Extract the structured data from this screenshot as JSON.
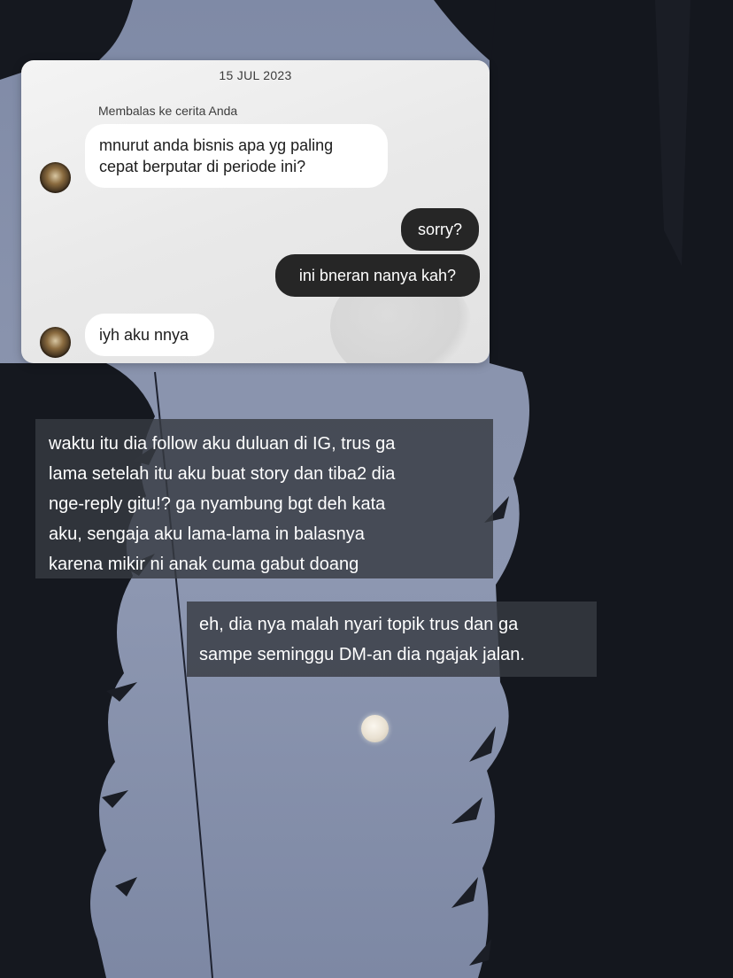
{
  "chat": {
    "date": "15 JUL 2023",
    "reply_note": "Membalas ke cerita Anda",
    "messages": [
      {
        "side": "in",
        "text": "mnurut anda bisnis apa yg paling cepat berputar di periode ini?"
      },
      {
        "side": "out",
        "text": "sorry?"
      },
      {
        "side": "out",
        "text": "ini bneran nanya kah?"
      },
      {
        "side": "in",
        "text": "iyh aku nnya"
      }
    ],
    "colors": {
      "incoming": "#ffffff",
      "outgoing": "#262626"
    }
  },
  "captions": [
    {
      "lines": [
        "waktu itu dia follow aku duluan di IG, trus ga",
        "lama setelah itu aku buat story dan tiba2 dia",
        "nge-reply gitu!? ga nyambung bgt deh kata",
        "aku, sengaja aku lama-lama in balasnya",
        "karena mikir ni anak cuma gabut doang"
      ]
    },
    {
      "lines": [
        "eh, dia nya malah nyari topik trus dan ga",
        "sampe seminggu DM-an dia ngajak jalan."
      ]
    }
  ]
}
